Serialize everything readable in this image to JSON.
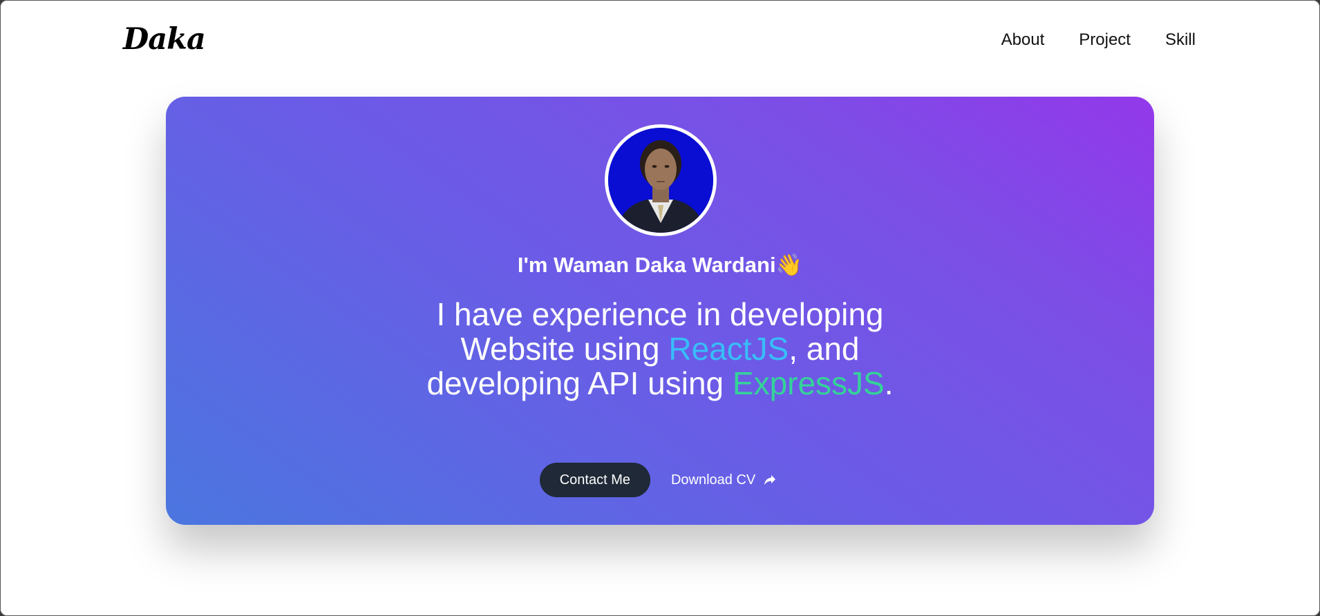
{
  "navbar": {
    "logo": "Daka",
    "links": [
      {
        "label": "About"
      },
      {
        "label": "Project"
      },
      {
        "label": "Skill"
      }
    ]
  },
  "hero": {
    "avatar": {
      "icon": "profile-photo",
      "background": "#0a0ed2"
    },
    "greeting": "I'm Waman Daka Wardani👋",
    "headline": {
      "part1": "I have experience in developing Website using ",
      "react": "ReactJS",
      "part2": ", and developing API using ",
      "express": "ExpressJS",
      "part3": "."
    },
    "contact_label": "Contact Me",
    "download_label": "Download CV",
    "download_icon": "share-arrow-icon"
  },
  "colors": {
    "gradient_start": "#4b76e0",
    "gradient_end": "#9338ea",
    "react_accent": "#38bdf8",
    "express_accent": "#34d399",
    "button_dark": "#1f2937"
  }
}
